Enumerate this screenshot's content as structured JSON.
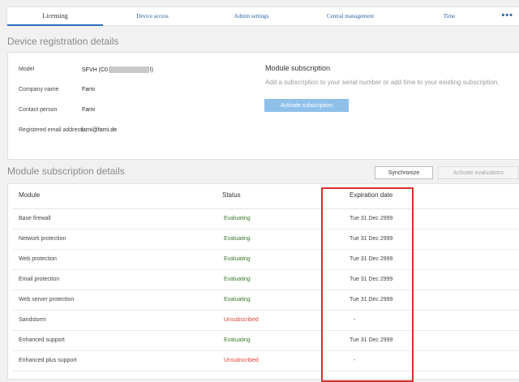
{
  "tabs": [
    {
      "label": "Licensing",
      "active": true
    },
    {
      "label": "Device access"
    },
    {
      "label": "Admin settings"
    },
    {
      "label": "Central management"
    },
    {
      "label": "Time"
    }
  ],
  "more_label": "•••",
  "registration": {
    "title": "Device registration details",
    "fields": {
      "model_label": "Model",
      "model_prefix": "SFVH (C0",
      "model_suffix": "l)",
      "company_label": "Company name",
      "company_value": "Farni",
      "contact_label": "Contact person",
      "contact_value": "Farni",
      "email_label": "Registered email address",
      "email_value": "farni@farni.de"
    },
    "subscription": {
      "title": "Module subscription",
      "description": "Add a subscription to your serial number or add time to your existing subscription.",
      "button": "Activate subscription"
    }
  },
  "modules": {
    "title": "Module subscription details",
    "synchronize_label": "Synchronize",
    "activate_evaluations_label": "Activate evaluations",
    "columns": {
      "module": "Module",
      "status": "Status",
      "expiration": "Expiration date"
    },
    "rows": [
      {
        "module": "Base firewall",
        "status": "Evaluating",
        "date": "Tue 31 Dec 2999"
      },
      {
        "module": "Network protection",
        "status": "Evaluating",
        "date": "Tue 31 Dec 2999"
      },
      {
        "module": "Web protection",
        "status": "Evaluating",
        "date": "Tue 31 Dec 2999"
      },
      {
        "module": "Email protection",
        "status": "Evaluating",
        "date": "Tue 31 Dec 2999"
      },
      {
        "module": "Web server protection",
        "status": "Evaluating",
        "date": "Tue 31 Dec 2999"
      },
      {
        "module": "Sandstorm",
        "status": "Unsubscribed",
        "date": "-"
      },
      {
        "module": "Enhanced support",
        "status": "Evaluating",
        "date": "Tue 31 Dec 2999"
      },
      {
        "module": "Enhanced plus support",
        "status": "Unsubscribed",
        "date": "-"
      }
    ]
  },
  "colors": {
    "evaluating": "#3b7a2e",
    "unsubscribed": "#e0453a",
    "highlight": "#d7302c",
    "accent": "#2b6dc0"
  }
}
